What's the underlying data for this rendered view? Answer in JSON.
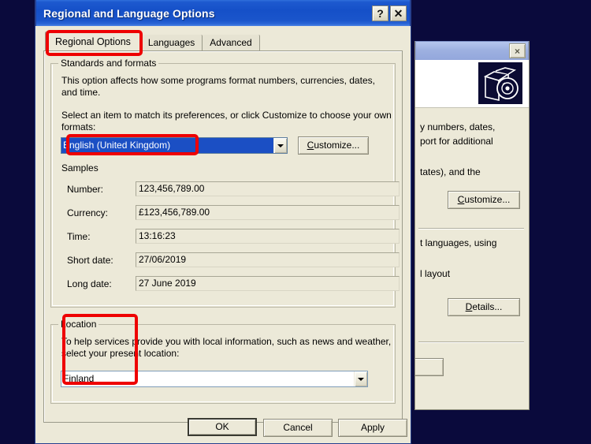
{
  "desktop": {
    "background_color": "#0a0a3c"
  },
  "background_window": {
    "close_label": "×",
    "icon_name": "software-box-cd-icon",
    "text_fragments": [
      "y numbers, dates,",
      "port for additional",
      "tates), and the",
      "t languages, using",
      "l layout"
    ],
    "buttons": [
      {
        "label": "Customize...",
        "mnemonic": "C"
      },
      {
        "label": "Details...",
        "mnemonic": "D"
      }
    ]
  },
  "dialog": {
    "title": "Regional and Language Options",
    "titlebar_color": "#1550c8",
    "help_button_label": "?",
    "close_button_label": "✕",
    "tabs": [
      {
        "label": "Regional Options",
        "active": true
      },
      {
        "label": "Languages",
        "active": false
      },
      {
        "label": "Advanced",
        "active": false
      }
    ],
    "standards_group": {
      "title": "Standards and formats",
      "description": "This option affects how some programs format numbers, currencies, dates, and time.",
      "instruction": "Select an item to match its preferences, or click Customize to choose your own formats:",
      "locale_value": "English (United Kingdom)",
      "customize_button": "Customize...",
      "customize_mnemonic": "C",
      "samples_title": "Samples",
      "samples": [
        {
          "label": "Number:",
          "value": "123,456,789.00"
        },
        {
          "label": "Currency:",
          "value": "£123,456,789.00"
        },
        {
          "label": "Time:",
          "value": "13:16:23"
        },
        {
          "label": "Short date:",
          "value": "27/06/2019"
        },
        {
          "label": "Long date:",
          "value": "27 June 2019"
        }
      ]
    },
    "location_group": {
      "title": "Location",
      "description": "To help services provide you with local information, such as news and weather, select your present location:",
      "value": "Finland"
    },
    "footer_buttons": [
      {
        "label": "OK",
        "default": true
      },
      {
        "label": "Cancel",
        "default": false
      },
      {
        "label": "Apply",
        "default": false
      }
    ]
  },
  "annotations": {
    "highlight_color": "#ee0000",
    "boxes": [
      {
        "name": "regional-options-tab-highlight"
      },
      {
        "name": "locale-combo-highlight"
      },
      {
        "name": "location-group-highlight"
      }
    ]
  }
}
